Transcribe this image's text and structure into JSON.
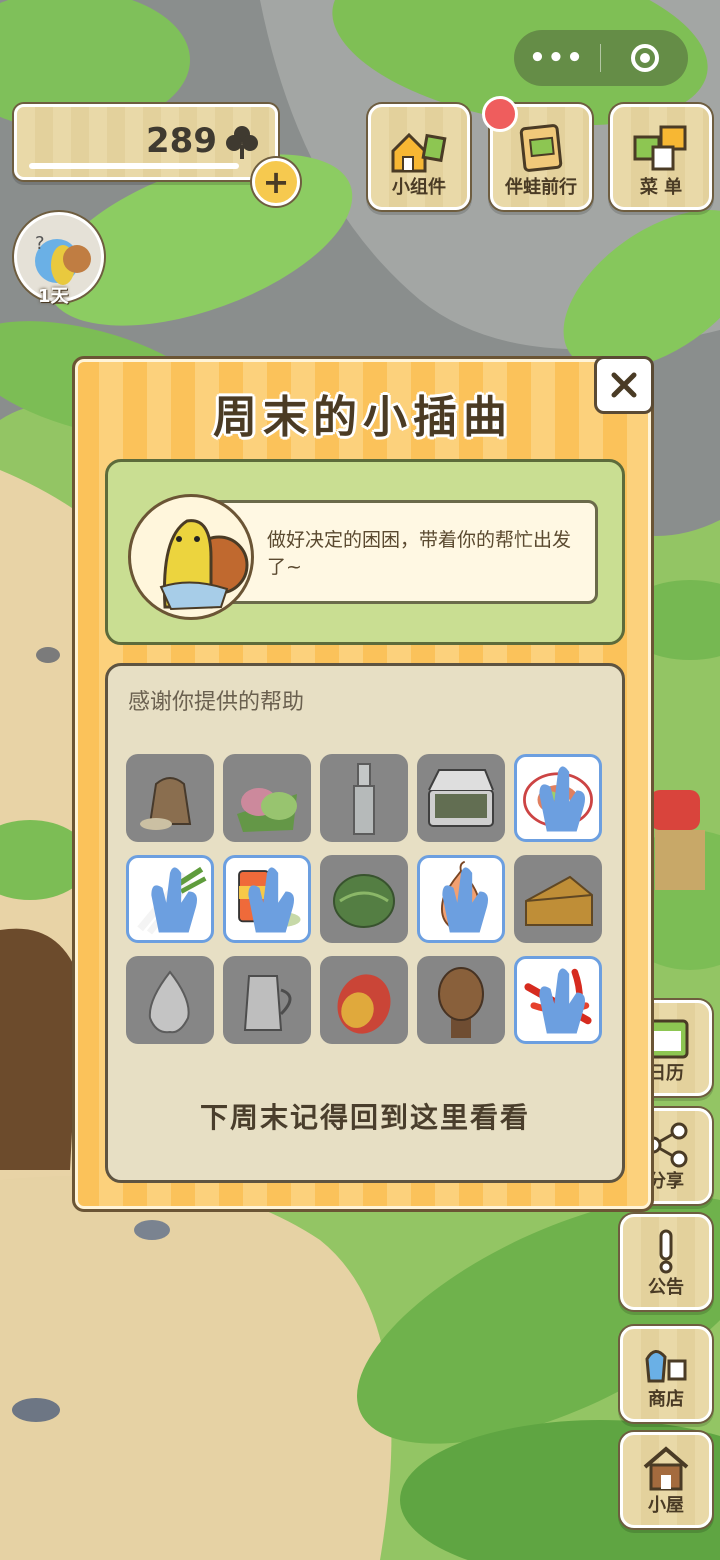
{
  "header": {
    "clover_count": "289",
    "plus_label": "+",
    "days_label": "1天"
  },
  "wechat_capsule": {
    "more_icon": "dots-icon",
    "close_icon": "target-icon"
  },
  "top_buttons": [
    {
      "label": "小组件",
      "icon": "widget-icon"
    },
    {
      "label": "伴蛙前行",
      "icon": "journey-icon",
      "badge": true
    },
    {
      "label": "菜 单",
      "icon": "menu-cards-icon"
    }
  ],
  "side_buttons": [
    {
      "label": "日历",
      "icon": "calendar-icon"
    },
    {
      "label": "分享",
      "icon": "share-icon"
    },
    {
      "label": "公告",
      "icon": "notice-icon"
    },
    {
      "label": "商店",
      "icon": "shop-icon"
    },
    {
      "label": "小屋",
      "icon": "house-icon"
    }
  ],
  "modal": {
    "title": "周末的小插曲",
    "story_text": "做好决定的困困，带着你的帮忙出发了~",
    "help_title": "感谢你提供的帮助",
    "footer_text": "下周末记得回到这里看看",
    "items": [
      {
        "name": "rice-sack",
        "active": false
      },
      {
        "name": "rice-cake",
        "active": false
      },
      {
        "name": "glass-bottle",
        "active": false
      },
      {
        "name": "bento-box",
        "active": false
      },
      {
        "name": "salad-plate",
        "active": true
      },
      {
        "name": "green-onion",
        "active": true
      },
      {
        "name": "spice-can",
        "active": true
      },
      {
        "name": "cabbage",
        "active": false
      },
      {
        "name": "onion",
        "active": true
      },
      {
        "name": "cheese",
        "active": false
      },
      {
        "name": "garlic",
        "active": false
      },
      {
        "name": "milk-jug",
        "active": false
      },
      {
        "name": "mango",
        "active": false
      },
      {
        "name": "pine-cone",
        "active": false
      },
      {
        "name": "chili-peppers",
        "active": true
      }
    ]
  },
  "colors": {
    "modal_stripe_a": "#fbc25a",
    "modal_stripe_b": "#fcd17c",
    "story_bg": "#c9de92",
    "help_bg": "#e7dfc4",
    "active_border": "#6c9fe0",
    "inactive_cell": "#868686"
  }
}
